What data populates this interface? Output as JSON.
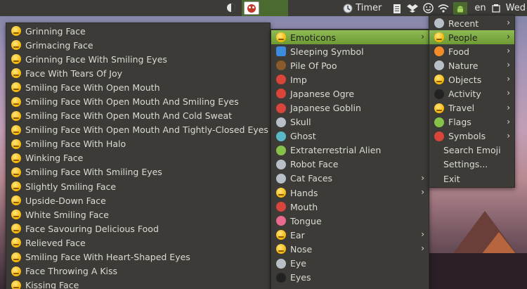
{
  "panel": {
    "timer_label": "Timer",
    "language": "en",
    "day_label": "Wed",
    "icons": [
      "dropbox-icon",
      "cloud-icon",
      "smiley-icon",
      "wifi-icon",
      "android-icon"
    ]
  },
  "category_menu": {
    "items": [
      {
        "label": "Recent",
        "icon": "clock-icon",
        "submenu": true
      },
      {
        "label": "People",
        "icon": "smiley-icon",
        "submenu": true,
        "highlighted": true
      },
      {
        "label": "Food",
        "icon": "tangerine-icon",
        "submenu": true
      },
      {
        "label": "Nature",
        "icon": "mouse-face-icon",
        "submenu": true
      },
      {
        "label": "Objects",
        "icon": "lightbulb-icon",
        "submenu": true
      },
      {
        "label": "Activity",
        "icon": "soccer-ball-icon",
        "submenu": true
      },
      {
        "label": "Travel",
        "icon": "taxi-icon",
        "submenu": true
      },
      {
        "label": "Flags",
        "icon": "brazil-flag-icon",
        "submenu": true
      },
      {
        "label": "Symbols",
        "icon": "exclamation-question-icon",
        "submenu": true
      },
      {
        "label": "Search Emoji",
        "submenu": false
      },
      {
        "label": "Settings...",
        "submenu": false
      },
      {
        "label": "Exit",
        "submenu": false
      }
    ]
  },
  "people_menu": {
    "items": [
      {
        "label": "Emoticons",
        "submenu": true,
        "highlighted": true
      },
      {
        "label": "Sleeping Symbol",
        "submenu": false
      },
      {
        "label": "Pile Of Poo",
        "submenu": false
      },
      {
        "label": "Imp",
        "submenu": false
      },
      {
        "label": "Japanese Ogre",
        "submenu": false
      },
      {
        "label": "Japanese Goblin",
        "submenu": false
      },
      {
        "label": "Skull",
        "submenu": false
      },
      {
        "label": "Ghost",
        "submenu": false
      },
      {
        "label": "Extraterrestrial Alien",
        "submenu": false
      },
      {
        "label": "Robot Face",
        "submenu": false
      },
      {
        "label": "Cat Faces",
        "submenu": true
      },
      {
        "label": "Hands",
        "submenu": true
      },
      {
        "label": "Mouth",
        "submenu": false
      },
      {
        "label": "Tongue",
        "submenu": false
      },
      {
        "label": "Ear",
        "submenu": true
      },
      {
        "label": "Nose",
        "submenu": true
      },
      {
        "label": "Eye",
        "submenu": false
      },
      {
        "label": "Eyes",
        "submenu": false
      }
    ]
  },
  "emoticons_menu": {
    "items": [
      "Grinning Face",
      "Grimacing Face",
      "Grinning Face With Smiling Eyes",
      "Face With Tears Of Joy",
      "Smiling Face With Open Mouth",
      "Smiling Face With Open Mouth And Smiling Eyes",
      "Smiling Face With Open Mouth And Cold Sweat",
      "Smiling Face With Open Mouth And Tightly-Closed Eyes",
      "Smiling Face With Halo",
      "Winking Face",
      "Smiling Face With Smiling Eyes",
      "Slightly Smiling Face",
      "Upside-Down Face",
      "White Smiling Face",
      "Face Savouring Delicious Food",
      "Relieved Face",
      "Smiling Face With Heart-Shaped Eyes",
      "Face Throwing A Kiss",
      "Kissing Face"
    ]
  }
}
